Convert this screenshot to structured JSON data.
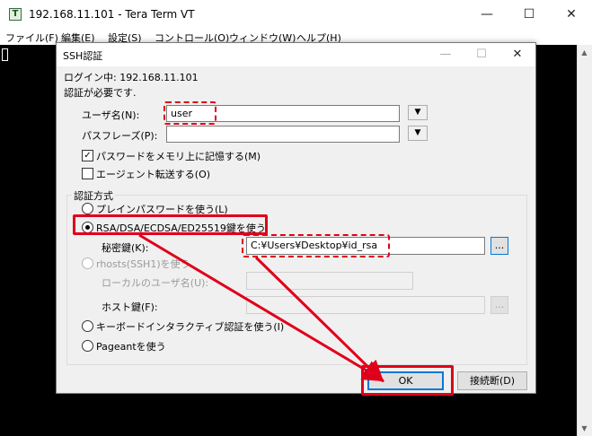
{
  "window": {
    "title": "192.168.11.101 - Tera Term VT",
    "app_icon_letter": "T",
    "controls": {
      "minimize": "—",
      "maximize": "☐",
      "close": "✕"
    }
  },
  "menubar": [
    "ファイル(F)",
    "編集(E)",
    "設定(S)",
    "コントロール(O)",
    "ウィンドウ(W)",
    "ヘルプ(H)"
  ],
  "dialog": {
    "title": "SSH認証",
    "controls": {
      "minimize": "—",
      "maximize": "☐",
      "close": "✕"
    },
    "login_status": "ログイン中: 192.168.11.101",
    "auth_required": "認証が必要です.",
    "username_label": "ユーザ名(N):",
    "username_value": "user",
    "passphrase_label": "パスフレーズ(P):",
    "passphrase_value": "",
    "remember_password": {
      "label": "パスワードをメモリ上に記憶する(M)",
      "checked": true,
      "mark": "✓"
    },
    "agent_forward": {
      "label": "エージェント転送する(O)",
      "checked": false
    },
    "auth_method_group": "認証方式",
    "methods": {
      "plain": {
        "label": "プレインパスワードを使う(L)",
        "selected": false
      },
      "rsa": {
        "label": "RSA/DSA/ECDSA/ED25519鍵を使う",
        "selected": true
      },
      "rhosts": {
        "label": "rhosts(SSH1)を使う",
        "selected": false,
        "disabled": true
      },
      "keyboard": {
        "label": "キーボードインタラクティブ認証を使う(I)",
        "selected": false
      },
      "pageant": {
        "label": "Pageantを使う",
        "selected": false
      }
    },
    "private_key_label": "秘密鍵(K):",
    "private_key_value": "C:¥Users¥Desktop¥id_rsa",
    "browse_label": "...",
    "local_user_label": "ローカルのユーザ名(U):",
    "host_key_label": "ホスト鍵(F):",
    "ok_label": "OK",
    "disconnect_label": "接続断(D)",
    "dropdown_arrow": "▼"
  },
  "colors": {
    "annotation_red": "#e0001b",
    "focus_blue": "#0078d7"
  }
}
